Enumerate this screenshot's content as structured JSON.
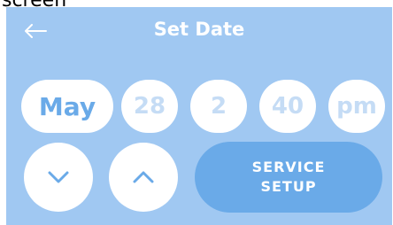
{
  "clipped_label": "screen",
  "header": {
    "title": "Set Date",
    "back_icon": "arrow-left-icon"
  },
  "picker": {
    "month": "May",
    "day": "28",
    "hour": "2",
    "minute": "40",
    "period": "pm"
  },
  "controls": {
    "down_icon": "chevron-down-icon",
    "up_icon": "chevron-up-icon",
    "service_line1": "SERVICE",
    "service_line2": "SETUP"
  },
  "colors": {
    "panel": "#a0c8f2",
    "accent": "#6aaae8",
    "dim_text": "#c5dcf5",
    "white": "#ffffff"
  }
}
